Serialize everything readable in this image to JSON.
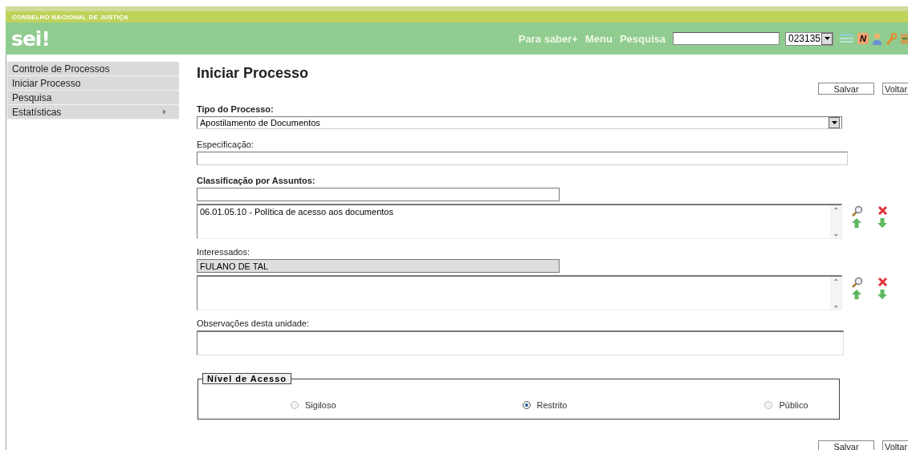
{
  "header": {
    "organization": "CONSELHO NACIONAL DE JUSTIÇA",
    "logo": "sei!",
    "links": [
      "Para saber+",
      "Menu",
      "Pesquisa"
    ],
    "unit_select": {
      "value": "023135"
    },
    "toolbar_badge": "N"
  },
  "sidebar": {
    "items": [
      {
        "label": "Controle de Processos",
        "has_submenu": false
      },
      {
        "label": "Iniciar Processo",
        "has_submenu": false
      },
      {
        "label": "Pesquisa",
        "has_submenu": false
      },
      {
        "label": "Estatísticas",
        "has_submenu": true
      }
    ]
  },
  "page": {
    "title": "Iniciar Processo",
    "buttons": [
      "Salvar",
      "Voltar"
    ],
    "fields": [
      {
        "kind": "select",
        "label": "Tipo do Processo:",
        "bold": true,
        "value": "Apostilamento de Documentos"
      },
      {
        "kind": "text",
        "label": "Especificação:",
        "bold": false
      },
      {
        "kind": "picker",
        "label": "Classificação por Assuntos:",
        "bold": true,
        "items": [
          "06.01.05.10 - Política de acesso aos documentos"
        ]
      },
      {
        "kind": "picker",
        "label": "Interessados:",
        "bold": false,
        "value": "FULANO DE TAL"
      },
      {
        "kind": "textarea",
        "label": "Observações desta unidade:",
        "bold": false
      }
    ],
    "access_level": {
      "legend": "Nível de Acesso",
      "options": [
        {
          "label": "Sigiloso",
          "selected": false
        },
        {
          "label": "Restrito",
          "selected": true
        },
        {
          "label": "Público",
          "selected": false
        }
      ]
    },
    "bottom_buttons": [
      "Salvar",
      "Voltar"
    ]
  }
}
